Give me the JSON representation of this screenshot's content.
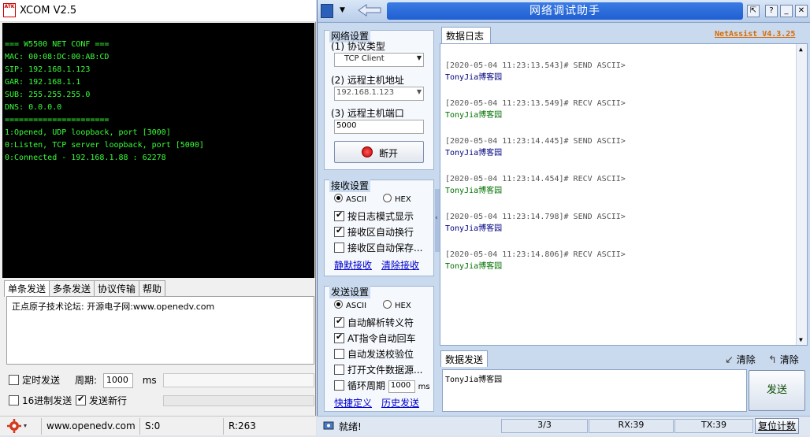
{
  "xcom": {
    "title": "XCOM V2.5",
    "logo_text": "ATK",
    "console_lines": [
      "=== W5500 NET CONF ===",
      "MAC: 00:08:DC:00:AB:CD",
      "SIP: 192.168.1.123",
      "GAR: 192.168.1.1",
      "SUB: 255.255.255.0",
      "DNS: 0.0.0.0",
      "======================",
      "1:Opened, UDP loopback, port [3000]",
      "0:Listen, TCP server loopback, port [5000]",
      "0:Connected - 192.168.1.88 : 62278"
    ],
    "tabs": [
      "单条发送",
      "多条发送",
      "协议传输",
      "帮助"
    ],
    "send_text": "正点原子技术论坛: 开源电子网:www.openedv.com",
    "timed_send_label": "定时发送",
    "period_label": "周期:",
    "period_value": "1000",
    "period_unit": "ms",
    "hex_send_label": "16进制发送",
    "send_newline_label": "发送新行",
    "status": {
      "url": "www.openedv.com",
      "sent": "S:0",
      "received": "R:263"
    }
  },
  "net": {
    "title": "网络调试助手",
    "version_link": "NetAssist V4.3.25",
    "net_settings_title": "网络设置",
    "protocol_label": "(1) 协议类型",
    "protocol_value": "TCP Client",
    "remote_addr_label": "(2) 远程主机地址",
    "remote_addr_value": "192.168.1.123",
    "remote_port_label": "(3) 远程主机端口",
    "remote_port_value": "5000",
    "disconnect_label": "断开",
    "recv_settings_title": "接收设置",
    "recv_ascii": "ASCII",
    "recv_hex": "HEX",
    "recv_log_mode": "按日志模式显示",
    "recv_auto_wrap": "接收区自动换行",
    "recv_auto_save": "接收区自动保存...",
    "silent_recv": "静默接收",
    "clear_recv": "清除接收",
    "send_settings_title": "发送设置",
    "send_ascii": "ASCII",
    "send_hex": "HEX",
    "auto_escape": "自动解析转义符",
    "at_auto_return": "AT指令自动回车",
    "auto_checksum": "自动发送校验位",
    "open_file_source": "打开文件数据源...",
    "loop_period_label": "循环周期",
    "loop_period_value": "1000",
    "loop_period_unit": "ms",
    "shortcut_def": "快捷定义",
    "history_send": "历史发送",
    "log_tab": "数据日志",
    "log": [
      {
        "head": "[2020-05-04 11:23:13.543]# SEND ASCII>",
        "body": "TonyJia博客园",
        "dir": "send"
      },
      {
        "head": "[2020-05-04 11:23:13.549]# RECV ASCII>",
        "body": "TonyJia博客园",
        "dir": "recv"
      },
      {
        "head": "[2020-05-04 11:23:14.445]# SEND ASCII>",
        "body": "TonyJia博客园",
        "dir": "send"
      },
      {
        "head": "[2020-05-04 11:23:14.454]# RECV ASCII>",
        "body": "TonyJia博客园",
        "dir": "recv"
      },
      {
        "head": "[2020-05-04 11:23:14.798]# SEND ASCII>",
        "body": "TonyJia博客园",
        "dir": "send"
      },
      {
        "head": "[2020-05-04 11:23:14.806]# RECV ASCII>",
        "body": "TonyJia博客园",
        "dir": "recv"
      }
    ],
    "send_tab": "数据发送",
    "clear_label_1": "清除",
    "clear_label_2": "清除",
    "send_text": "TonyJia博客园",
    "send_button": "发送",
    "status": {
      "ready": "就绪!",
      "count": "3/3",
      "rx": "RX:39",
      "tx": "TX:39",
      "reset": "复位计数"
    }
  }
}
